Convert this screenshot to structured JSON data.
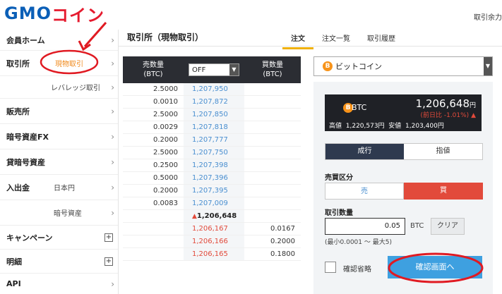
{
  "header": {
    "logo_gmo": "GMO",
    "logo_coin": "コイン",
    "right_link": "取引余力"
  },
  "sidebar": {
    "home": "会員ホーム",
    "exchange": "取引所",
    "spot": "現物取引",
    "leverage": "レバレッジ取引",
    "sales": "販売所",
    "crypto_fx": "暗号資産FX",
    "lending": "貸暗号資産",
    "deposit": "入出金",
    "jpy": "日本円",
    "crypto": "暗号資産",
    "campaign": "キャンペーン",
    "statement": "明細",
    "api": "API"
  },
  "main": {
    "title": "取引所（現物取引）",
    "tabs": [
      "注文",
      "注文一覧",
      "取引履歴"
    ]
  },
  "orderbook": {
    "sell_header": [
      "売数量",
      "(BTC)"
    ],
    "buy_header": [
      "買数量",
      "(BTC)"
    ],
    "filter_value": "OFF",
    "asks": [
      {
        "qty": "2.5000",
        "price": "1,207,950"
      },
      {
        "qty": "0.0010",
        "price": "1,207,872"
      },
      {
        "qty": "2.5000",
        "price": "1,207,850"
      },
      {
        "qty": "0.0029",
        "price": "1,207,818"
      },
      {
        "qty": "0.2000",
        "price": "1,207,777"
      },
      {
        "qty": "2.5000",
        "price": "1,207,750"
      },
      {
        "qty": "0.2500",
        "price": "1,207,398"
      },
      {
        "qty": "0.5000",
        "price": "1,207,396"
      },
      {
        "qty": "0.2000",
        "price": "1,207,395"
      },
      {
        "qty": "0.0083",
        "price": "1,207,009"
      }
    ],
    "last_price": "1,206,648",
    "bids": [
      {
        "price": "1,206,167",
        "qty": "0.0167"
      },
      {
        "price": "1,206,166",
        "qty": "0.2000"
      },
      {
        "price": "1,206,165",
        "qty": "0.1800"
      }
    ]
  },
  "order_panel": {
    "coin": "ビットコイン",
    "symbol": "BTC",
    "price": "1,206,648",
    "price_unit": "円",
    "change": "(前日比 -1.01%)",
    "high_label": "高値",
    "high": "1,220,573円",
    "low_label": "安値",
    "low": "1,203,400円",
    "type_market": "成行",
    "type_limit": "指値",
    "side_label": "売買区分",
    "sell": "売",
    "buy": "買",
    "qty_label": "取引数量",
    "qty_value": "0.05",
    "qty_unit": "BTC",
    "clear": "クリア",
    "qty_range": "(最小0.0001 ～ 最大5)",
    "skip_confirm": "確認省略",
    "confirm_button": "確認画面へ"
  },
  "colors": {
    "accent_annotation": "#e01a22",
    "buy_red": "#e24a3b",
    "sell_blue": "#4a8fd0",
    "confirm_blue": "#3ea0e0"
  }
}
